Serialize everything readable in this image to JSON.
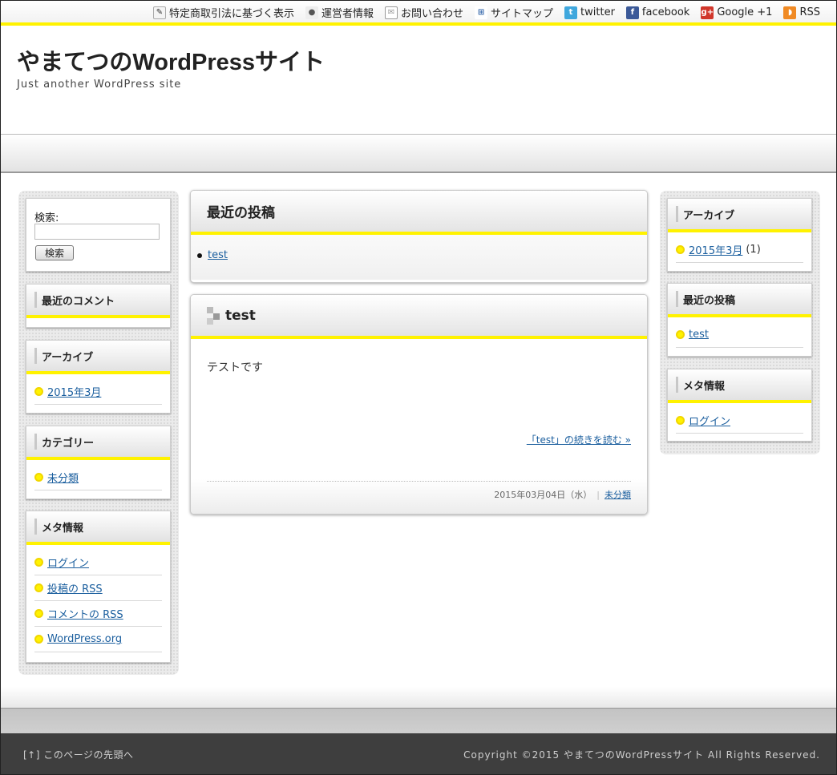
{
  "top_links": [
    {
      "label": "特定商取引法に基づく表示",
      "icon": "memo-icon",
      "glyph": "✎"
    },
    {
      "label": "運営者情報",
      "icon": "person-icon",
      "glyph": "●"
    },
    {
      "label": "お問い合わせ",
      "icon": "mail-icon",
      "glyph": "✉"
    },
    {
      "label": "サイトマップ",
      "icon": "sitemap-icon",
      "glyph": "⊞"
    },
    {
      "label": "twitter",
      "icon": "twitter-icon",
      "glyph": "t"
    },
    {
      "label": "facebook",
      "icon": "facebook-icon",
      "glyph": "f"
    },
    {
      "label": "Google +1",
      "icon": "google-plus-icon",
      "glyph": "g+"
    },
    {
      "label": "RSS",
      "icon": "rss-icon",
      "glyph": "◗"
    }
  ],
  "header": {
    "title": "やまてつのWordPressサイト",
    "description": "Just another WordPress site"
  },
  "left_sidebar": {
    "search": {
      "label": "検索:",
      "button": "検索",
      "value": ""
    },
    "recent_comments": {
      "title": "最近のコメント"
    },
    "archives": {
      "title": "アーカイブ",
      "items": [
        "2015年3月"
      ]
    },
    "categories": {
      "title": "カテゴリー",
      "items": [
        "未分類"
      ]
    },
    "meta": {
      "title": "メタ情報",
      "items": [
        "ログイン",
        "投稿の RSS",
        "コメントの RSS",
        "WordPress.org"
      ]
    }
  },
  "main": {
    "recent_posts": {
      "title": "最近の投稿",
      "items": [
        "test"
      ]
    },
    "post": {
      "title": "test",
      "content": "テストです",
      "more_link": "「test」の続きを読む »",
      "date": "2015年03月04日（水）",
      "separator": "|",
      "category": "未分類"
    }
  },
  "right_sidebar": {
    "archives": {
      "title": "アーカイブ",
      "items": [
        {
          "label": "2015年3月",
          "count": "(1)"
        }
      ]
    },
    "recent_posts": {
      "title": "最近の投稿",
      "items": [
        "test"
      ]
    },
    "meta": {
      "title": "メタ情報",
      "items": [
        "ログイン"
      ]
    }
  },
  "footer": {
    "to_top": "[↑] このページの先頭へ",
    "copyright": "Copyright ©2015 やまてつのWordPressサイト All Rights Reserved."
  },
  "colors": {
    "accent_yellow": "#fff200",
    "link": "#1a5e9e",
    "footer_bg": "#3e3e3e"
  }
}
